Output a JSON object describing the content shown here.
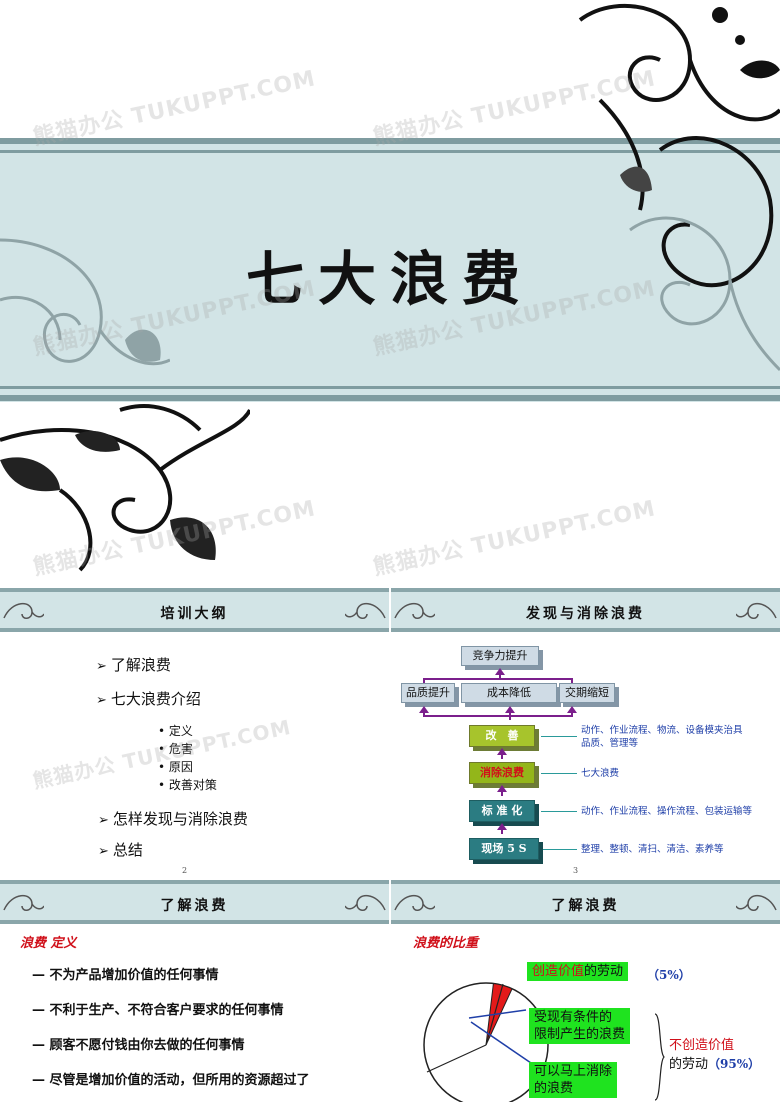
{
  "cover": {
    "title": "七大浪费",
    "watermark": "熊猫办公 TUKUPPT.COM"
  },
  "outline": {
    "header": "培训大纲",
    "items": [
      {
        "label": "了解浪费"
      },
      {
        "label": "七大浪费介绍"
      },
      {
        "label": "怎样发现与消除浪费"
      },
      {
        "label": "总结"
      }
    ],
    "subitems": [
      "定义",
      "危害",
      "原因",
      "改善对策"
    ],
    "page": "2"
  },
  "discover": {
    "header": "发现与消除浪费",
    "page": "3",
    "top_box": "竞争力提升",
    "mid_boxes": [
      "品质提升",
      "成本降低",
      "交期缩短"
    ],
    "steps": [
      {
        "label": "改　善",
        "note": "动作、作业流程、物流、设备模夹治具\n品质、管理等"
      },
      {
        "label": "消除浪费",
        "note": "七大浪费"
      },
      {
        "label": "标 准 化",
        "note": "动作、作业流程、操作流程、包装运输等"
      },
      {
        "label": "现场 5 S",
        "note": "整理、整顿、清扫、清洁、素养等"
      }
    ],
    "colors": {
      "arrow": "#7b1f8c",
      "green": "#93b61a",
      "teal": "#2b7c82"
    }
  },
  "definition": {
    "header": "了解浪费",
    "section": "浪费 定义",
    "items": [
      "— 不为产品增加价值的任何事情",
      "— 不利于生产、不符合客户要求的任何事情",
      "— 顾客不愿付钱由你去做的任何事情",
      "— 尽管是增加价值的活动，但所用的资源超过了"
    ]
  },
  "ratio": {
    "header": "了解浪费",
    "section": "浪费的比重",
    "value_label_a": "创造价值",
    "value_label_b": "的劳动",
    "value_pct": "（5%）",
    "limited_label": "受现有条件的\n限制产生的浪费",
    "immediate_label": "可以马上消除\n的浪费",
    "non_value_label": "不创造价值",
    "non_value_label2": "的劳动",
    "non_value_pct": "（95%）",
    "value_fraction": 0.05,
    "colors": {
      "value": "#e31a1a",
      "label_bg": "#1fe31f",
      "red_text": "#d0101a",
      "blue_text": "#1f3fa8"
    }
  }
}
